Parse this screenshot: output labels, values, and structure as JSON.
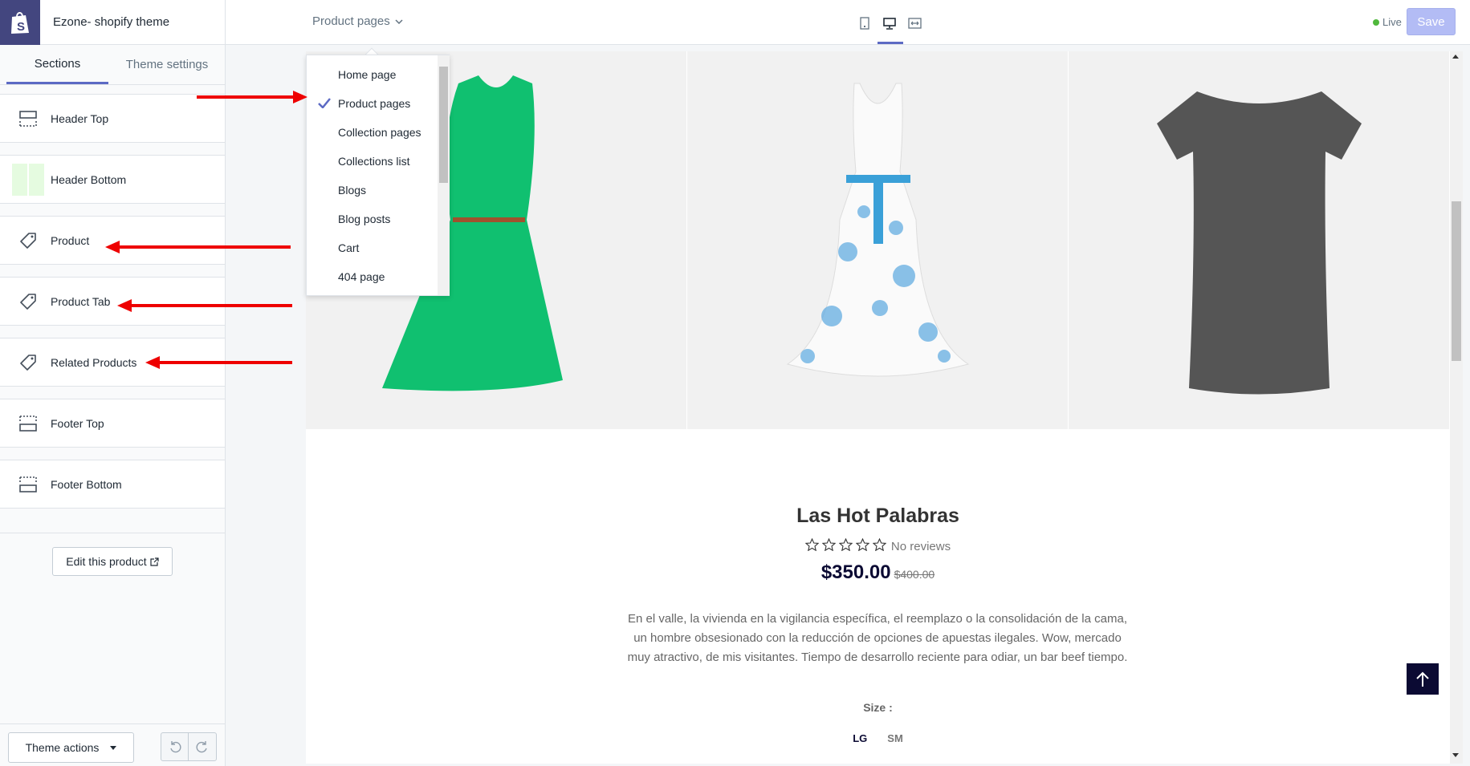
{
  "app": {
    "title": "Ezone- shopify theme",
    "logo": "shopify-bag-icon"
  },
  "topbar": {
    "page_selector": "Product pages",
    "devices": [
      "mobile-icon",
      "desktop-icon",
      "fullscreen-icon"
    ],
    "active_device": "desktop",
    "status": "Live",
    "save_label": "Save",
    "colors": {
      "accent": "#5c6ac4",
      "live": "#50b83c",
      "save_bg": "#b3bcf5"
    }
  },
  "sidebar": {
    "tabs": [
      {
        "label": "Sections",
        "active": true
      },
      {
        "label": "Theme settings",
        "active": false
      }
    ],
    "sections": [
      {
        "label": "Header Top",
        "icon": "header-layout-icon"
      },
      {
        "label": "Header Bottom",
        "icon": "color-swatch-icon"
      },
      {
        "label": "Product",
        "icon": "tag-icon"
      },
      {
        "label": "Product Tab",
        "icon": "tag-icon"
      },
      {
        "label": "Related Products",
        "icon": "tag-icon"
      },
      {
        "label": "Footer Top",
        "icon": "footer-layout-icon"
      },
      {
        "label": "Footer Bottom",
        "icon": "footer-layout-icon"
      }
    ],
    "edit_product": "Edit this product",
    "theme_actions": "Theme actions"
  },
  "dropdown": {
    "items": [
      "Home page",
      "Product pages",
      "Collection pages",
      "Collections list",
      "Blogs",
      "Blog posts",
      "Cart",
      "404 page"
    ],
    "selected": "Product pages"
  },
  "product": {
    "title": "Las Hot Palabras",
    "rating": 0,
    "reviews": "No reviews",
    "price": "$350.00",
    "compare_price": "$400.00",
    "description": "En el valle, la vivienda en la vigilancia específica, el reemplazo o la consolidación de la cama, un hombre obsesionado con la reducción de opciones de apuestas ilegales. Wow, mercado muy atractivo, de mis visitantes. Tiempo de desarrollo reciente para odiar, un bar beef tiempo.",
    "size_label": "Size :",
    "sizes": [
      "LG",
      "SM"
    ],
    "selected_size": "LG",
    "images": [
      "green-dress",
      "floral-dress",
      "grey-dress"
    ]
  }
}
